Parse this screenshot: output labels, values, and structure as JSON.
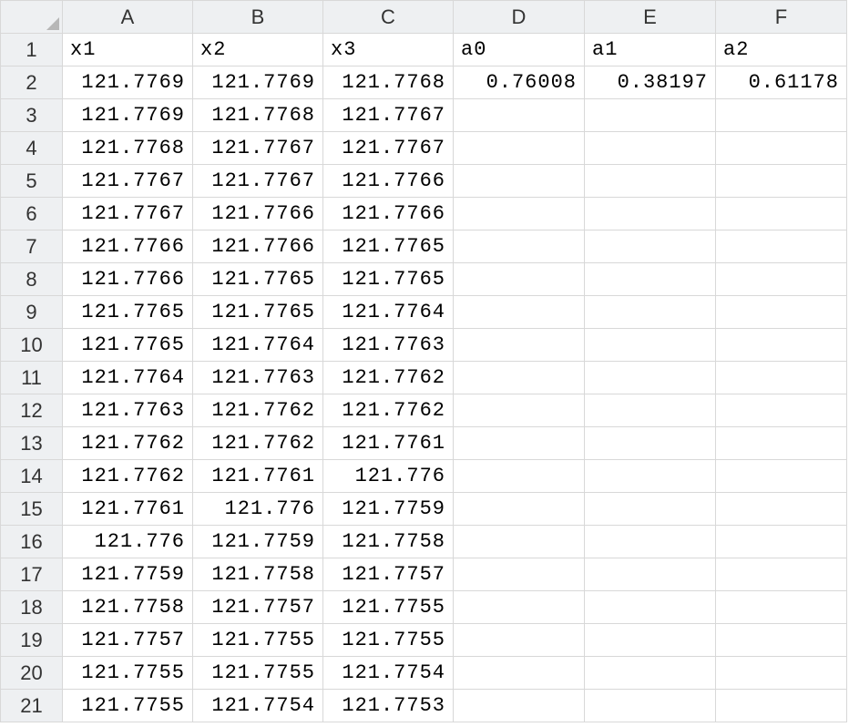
{
  "columns": [
    "A",
    "B",
    "C",
    "D",
    "E",
    "F"
  ],
  "rowCount": 21,
  "headers": {
    "A": "x1",
    "B": "x2",
    "C": "x3",
    "D": "a0",
    "E": "a1",
    "F": "a2"
  },
  "rows": [
    {
      "A": "121.7769",
      "B": "121.7769",
      "C": "121.7768",
      "D": "0.76008",
      "E": "0.38197",
      "F": "0.61178"
    },
    {
      "A": "121.7769",
      "B": "121.7768",
      "C": "121.7767"
    },
    {
      "A": "121.7768",
      "B": "121.7767",
      "C": "121.7767"
    },
    {
      "A": "121.7767",
      "B": "121.7767",
      "C": "121.7766"
    },
    {
      "A": "121.7767",
      "B": "121.7766",
      "C": "121.7766"
    },
    {
      "A": "121.7766",
      "B": "121.7766",
      "C": "121.7765"
    },
    {
      "A": "121.7766",
      "B": "121.7765",
      "C": "121.7765"
    },
    {
      "A": "121.7765",
      "B": "121.7765",
      "C": "121.7764"
    },
    {
      "A": "121.7765",
      "B": "121.7764",
      "C": "121.7763"
    },
    {
      "A": "121.7764",
      "B": "121.7763",
      "C": "121.7762"
    },
    {
      "A": "121.7763",
      "B": "121.7762",
      "C": "121.7762"
    },
    {
      "A": "121.7762",
      "B": "121.7762",
      "C": "121.7761"
    },
    {
      "A": "121.7762",
      "B": "121.7761",
      "C": "121.776"
    },
    {
      "A": "121.7761",
      "B": "121.776",
      "C": "121.7759"
    },
    {
      "A": "121.776",
      "B": "121.7759",
      "C": "121.7758"
    },
    {
      "A": "121.7759",
      "B": "121.7758",
      "C": "121.7757"
    },
    {
      "A": "121.7758",
      "B": "121.7757",
      "C": "121.7755"
    },
    {
      "A": "121.7757",
      "B": "121.7755",
      "C": "121.7755"
    },
    {
      "A": "121.7755",
      "B": "121.7755",
      "C": "121.7754"
    },
    {
      "A": "121.7755",
      "B": "121.7754",
      "C": "121.7753"
    }
  ]
}
